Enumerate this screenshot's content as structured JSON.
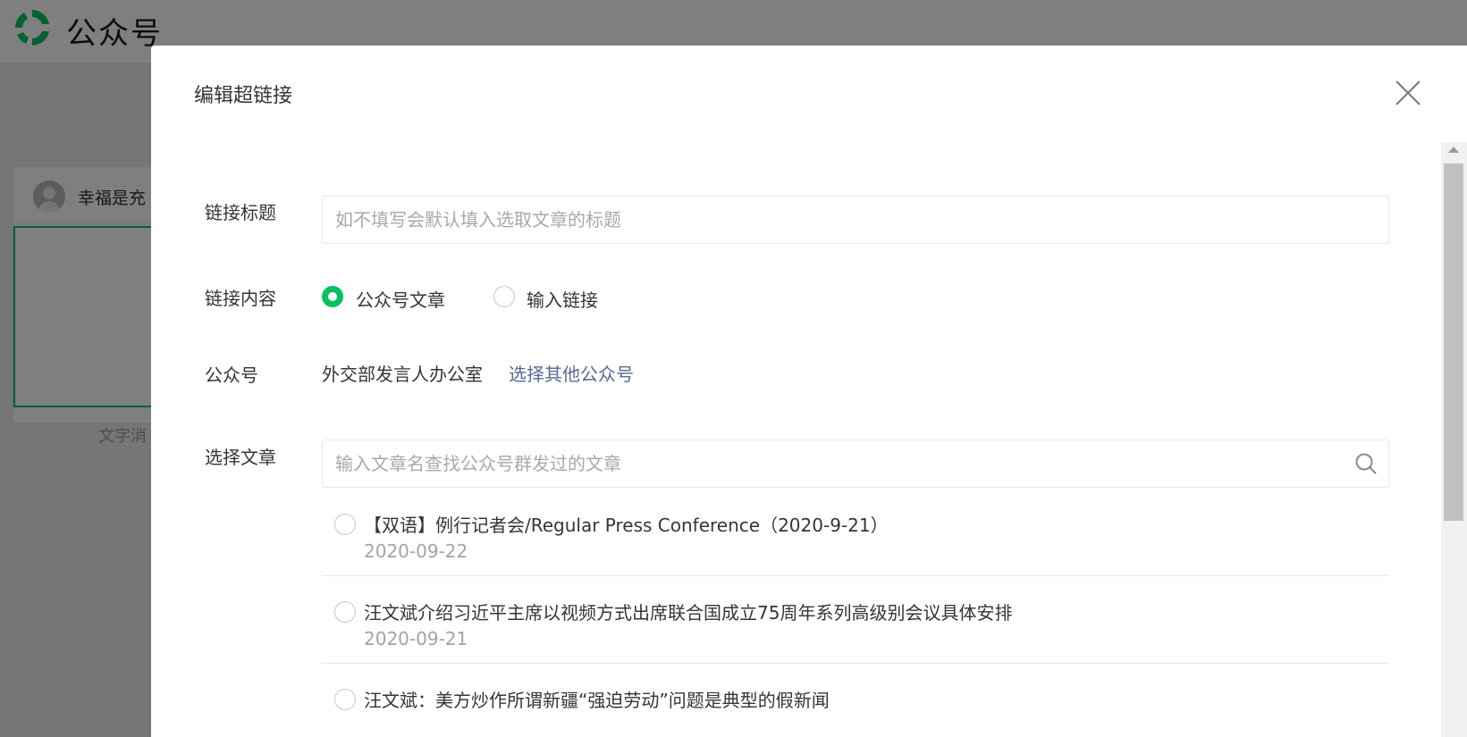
{
  "app": {
    "title": "公众号"
  },
  "background": {
    "user_name": "幸福是充",
    "caption": "文字消"
  },
  "dialog": {
    "title": "编辑超链接",
    "link_title": {
      "label": "链接标题",
      "value": "",
      "placeholder": "如不填写会默认填入选取文章的标题"
    },
    "link_content": {
      "label": "链接内容",
      "options": [
        {
          "label": "公众号文章",
          "selected": true
        },
        {
          "label": "输入链接",
          "selected": false
        }
      ]
    },
    "account": {
      "label": "公众号",
      "name": "外交部发言人办公室",
      "change_link": "选择其他公众号"
    },
    "article_search": {
      "label": "选择文章",
      "value": "",
      "placeholder": "输入文章名查找公众号群发过的文章"
    },
    "articles": [
      {
        "title": "【双语】例行记者会/Regular Press Conference（2020-9-21）",
        "date": "2020-09-22",
        "selected": false
      },
      {
        "title": "汪文斌介绍习近平主席以视频方式出席联合国成立75周年系列高级别会议具体安排",
        "date": "2020-09-21",
        "selected": false
      },
      {
        "title": "汪文斌：美方炒作所谓新疆“强迫劳动”问题是典型的假新闻",
        "date": "",
        "selected": false
      }
    ]
  },
  "colors": {
    "accent": "#07c160",
    "link": "#576b95",
    "overlay": "rgba(0,0,0,0.5)"
  },
  "icons": {
    "logo": "wechat-official-account-logo",
    "close": "close-icon",
    "search": "search-icon",
    "avatar": "user-avatar-icon"
  }
}
